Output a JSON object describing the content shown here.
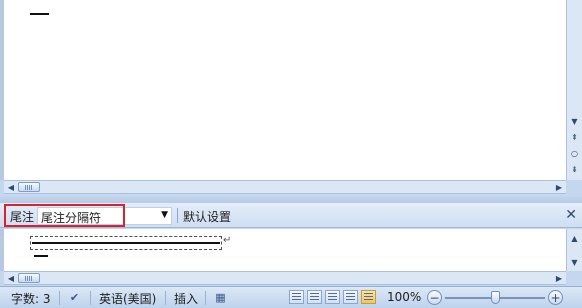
{
  "note_bar": {
    "type_label": "尾注",
    "selected_option": "尾注分隔符",
    "default_settings": "默认设置"
  },
  "status_bar": {
    "word_count_label": "字数: 3",
    "language": "英语(美国)",
    "insert_mode": "插入",
    "zoom_level": "100%"
  },
  "glyphs": {
    "scroll_up": "▲",
    "scroll_down": "▼",
    "scroll_left": "◀",
    "scroll_right": "▶",
    "prev_page": "⇞",
    "select_browse": "○",
    "next_page": "⇟",
    "dropdown": "▼",
    "close": "✕",
    "return_mark": "↵",
    "zoom_out": "−",
    "zoom_in": "+",
    "spell_check": "✔",
    "macro": "▦"
  },
  "colors": {
    "highlight_border": "#d7242c",
    "status_bar": "#bed3ed"
  },
  "zoom_slider_fraction": 0.5
}
